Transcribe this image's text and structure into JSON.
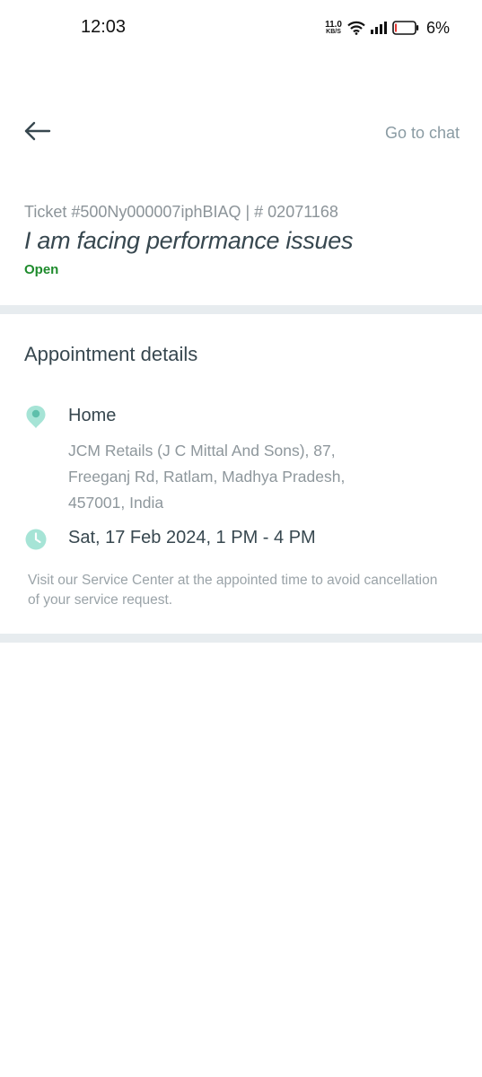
{
  "status_bar": {
    "time": "12:03",
    "net_speed": "11.0",
    "net_unit": "KB/S",
    "battery": "6%",
    "icons": [
      "wifi-icon",
      "signal-icon",
      "battery-icon"
    ]
  },
  "header": {
    "back_icon": "arrow-left-icon",
    "chat_label": "Go to chat"
  },
  "ticket": {
    "id_line": "Ticket #500Ny000007iphBIAQ | # 02071168",
    "title": "I am facing performance issues",
    "status": "Open",
    "status_color": "#1e8b2c"
  },
  "appointment": {
    "heading": "Appointment details",
    "location_icon": "location-pin-icon",
    "location_label": "Home",
    "address_lines": [
      "JCM Retails (J C Mittal And Sons), 87,",
      "Freeganj Rd, Ratlam, Madhya Pradesh,",
      "457001, India"
    ],
    "time_icon": "clock-icon",
    "datetime": "Sat, 17 Feb 2024, 1 PM - 4 PM",
    "note": "Visit our Service Center at the appointed time to avoid cancellation of your service request."
  },
  "colors": {
    "accent": "#7fd6c4",
    "divider": "#e7ecef",
    "text_primary": "#37474f",
    "text_secondary": "#8e979c"
  }
}
